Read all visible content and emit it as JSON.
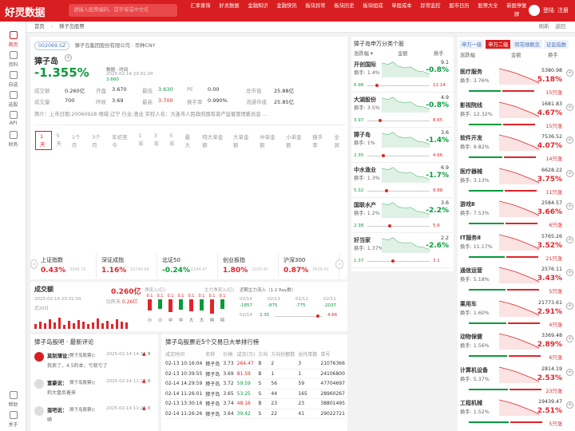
{
  "app": {
    "logo": "好灵数据",
    "search_placeholder": "请输入股票编码、首字母或中文名"
  },
  "nav": [
    "汇率查询",
    "好灵数据",
    "金融知识",
    "金融快讯",
    "板块异常",
    "板块历史",
    "板块组成",
    "单股成本",
    "异常监控",
    "股市日历",
    "股票大全",
    "新股停复牌"
  ],
  "user": {
    "login": "登陆",
    "register": "注册"
  },
  "sidebar": [
    {
      "label": "首页",
      "icon": "home-icon"
    },
    {
      "label": "资料",
      "icon": "doc-icon"
    },
    {
      "label": "自选",
      "icon": "star-icon"
    },
    {
      "label": "选股",
      "icon": "filter-icon"
    },
    {
      "label": "API",
      "icon": "api-icon"
    },
    {
      "label": "财务",
      "icon": "finance-icon"
    },
    {
      "label": "帮助",
      "icon": "help-icon"
    },
    {
      "label": "关于",
      "icon": "about-icon"
    }
  ],
  "breadcrumb": {
    "home": "首页",
    "current": "獐子岛股票",
    "refresh": "刷新",
    "back": "返回"
  },
  "stock": {
    "code": "002069.SZ",
    "company": "獐子岛集团股份有限公司 · 币种CNY",
    "name": "獐子岛",
    "time_label": "数据 · 时间",
    "time": "2025-02-14 23:01:34",
    "price": "3.660",
    "change": "-1.355%",
    "fields": [
      {
        "k": "成交额",
        "v": "0.260亿"
      },
      {
        "k": "开盘",
        "v": "3.670"
      },
      {
        "k": "最低",
        "v": "3.630"
      },
      {
        "k": "PE",
        "v": "0.00"
      },
      {
        "k": "总市值",
        "v": "25.88亿"
      },
      {
        "k": "成交量",
        "v": "700"
      },
      {
        "k": "昨收",
        "v": "3.69"
      },
      {
        "k": "最高",
        "v": "3.700"
      },
      {
        "k": "换手率",
        "v": "0.990%"
      },
      {
        "k": "流通市值",
        "v": "25.85亿"
      }
    ],
    "intro": "简介：上市日期:20060928 地域:辽宁 行业:渔业 实控人名：大连市人民政府国有资产监督管理委员会 ..."
  },
  "chart_tabs": [
    "1天",
    "5天",
    "1个月",
    "3个月",
    "年初至今",
    "1年",
    "3年",
    "5年",
    "最大",
    "特大单金额",
    "大单金额",
    "中单金额",
    "小单金额",
    "换手率",
    "全屏"
  ],
  "indices": [
    {
      "name": "上证指数",
      "pct": "0.43%",
      "sub": "3346.72",
      "dir": "up"
    },
    {
      "name": "深证成指",
      "pct": "1.16%",
      "sub": "10749.64",
      "dir": "up"
    },
    {
      "name": "北证50",
      "pct": "-0.24%",
      "sub": "1344.47",
      "dir": "down"
    },
    {
      "name": "创业板指",
      "pct": "1.80%",
      "sub": "2200.90",
      "dir": "up"
    },
    {
      "name": "沪深300",
      "pct": "0.87%",
      "sub": "3939.01",
      "dir": "up"
    }
  ],
  "volume": {
    "title": "成交额",
    "value": "0.260亿",
    "time": "2025-02-14 23:01:34",
    "ratio_label": "比昨天",
    "ratio": "0.26亿",
    "days_label": "近20日",
    "flow_label": "净流入(亿)",
    "main_label": "主力净流入(亿)",
    "flow_values": [
      "0.1",
      "0.1",
      "0.1",
      "0.1",
      "0.1",
      "0.1",
      "0.1",
      "0.1"
    ],
    "flow_cats": [
      "小",
      "小",
      "中",
      "中",
      "大",
      "大",
      "特",
      "特"
    ],
    "recent_title": "近期主力流入（1.2 Ray数）",
    "recent_dates": [
      "02/14",
      "02/13",
      "02/12",
      "02/11"
    ],
    "recent_vals": [
      "-1857",
      "-875",
      "-775",
      "-2037"
    ],
    "price_label": "02/14",
    "price_min": "2.35",
    "price_max": "4.66"
  },
  "comments": {
    "title": "獐子岛股吧 · 最新评论",
    "items": [
      {
        "user": "莫制薄设：",
        "src": "獐子岛股票()",
        "time": "2025-02-14 14:34",
        "likes": "8",
        "text": "我卖了，4.5的本，亏就亏了"
      },
      {
        "user": "富豪说：",
        "src": "獐子岛股票()",
        "time": "2025-02-14 11:27",
        "likes": "0",
        "text": "和大盘反着来"
      },
      {
        "user": "蛋吧说：",
        "src": "獐子岛股票()",
        "time": "2025-02-14 11:26",
        "likes": "0",
        "text": "嗬"
      }
    ]
  },
  "trades": {
    "title": "獐子岛股票近5个交易日大单排行榜",
    "headers": [
      "成交时间",
      "",
      "名称",
      "价格",
      "成交(万)",
      "方向",
      "方向份额数",
      "总托单数",
      "单号"
    ],
    "rows": [
      [
        "02-13 10:16:04",
        "獐子岛",
        "3.73",
        "264.47",
        "B",
        "2",
        "3",
        "21076366"
      ],
      [
        "02-13 10:39:55",
        "獐子岛",
        "3.69",
        "81.59",
        "B",
        "1",
        "1",
        "24106800"
      ],
      [
        "02-14 14:29:59",
        "獐子岛",
        "3.72",
        "59.59",
        "S",
        "56",
        "59",
        "47704697"
      ],
      [
        "02-14 11:26:01",
        "獐子岛",
        "3.65",
        "53.25",
        "S",
        "44",
        "165",
        "28960267"
      ],
      [
        "02-13 13:30:16",
        "獐子岛",
        "3.74",
        "48.16",
        "B",
        "23",
        "23",
        "38801495"
      ],
      [
        "02-14 11:26:26",
        "獐子岛",
        "3.64",
        "39.42",
        "S",
        "22",
        "41",
        "29022721"
      ]
    ]
  },
  "fish": {
    "title": "獐子岛申万分类个股",
    "cols": [
      "金额",
      "换手"
    ],
    "items": [
      {
        "name": "开创国际",
        "turnover": "换手: 1.4%",
        "price": "9.1",
        "pct": "-0.8%",
        "lo": "6.98",
        "hi": "12.14",
        "dir": "down"
      },
      {
        "name": "大湖股份",
        "turnover": "换手: 3.5%",
        "price": "4.9",
        "pct": "-0.8%",
        "lo": "3.97",
        "hi": "8.65",
        "dir": "down"
      },
      {
        "name": "獐子岛",
        "turnover": "换手: 1%",
        "price": "3.6",
        "pct": "-1.4%",
        "lo": "2.35",
        "hi": "4.66",
        "dir": "down"
      },
      {
        "name": "中水渔业",
        "turnover": "换手: 1.3%",
        "price": "6.9",
        "pct": "-1.7%",
        "lo": "5.32",
        "hi": "8.88",
        "dir": "down"
      },
      {
        "name": "国联水产",
        "turnover": "换手: 1.2%",
        "price": "3.6",
        "pct": "-2.2%",
        "lo": "2.38",
        "hi": "5.6",
        "dir": "down"
      },
      {
        "name": "好当家",
        "turnover": "换手: 1.37%",
        "price": "2.2",
        "pct": "-2.6%",
        "lo": "1.37",
        "hi": "3.1",
        "dir": "down"
      }
    ]
  },
  "industry": {
    "tabs": [
      "申万一级",
      "申万二级",
      "同花顺概念",
      "证监指数"
    ],
    "cols": [
      "涨跌幅",
      "金额",
      "换手"
    ],
    "items": [
      {
        "name": "医疗服务",
        "turnover": "换手: 3.76%",
        "price": "5380.98",
        "pct": "5.18%",
        "vol": "15只涨"
      },
      {
        "name": "影视院线",
        "turnover": "换手: 12.32%",
        "price": "1681.83",
        "pct": "4.67%",
        "vol": "15只涨"
      },
      {
        "name": "软件开发",
        "turnover": "换手: 9.82%",
        "price": "7536.52",
        "pct": "4.07%",
        "vol": "14只涨"
      },
      {
        "name": "医疗器械",
        "turnover": "换手: 3.13%",
        "price": "6628.22",
        "pct": "3.75%",
        "vol": "11只涨"
      },
      {
        "name": "游戏Ⅱ",
        "turnover": "换手: 7.53%",
        "price": "2584.57",
        "pct": "3.66%",
        "vol": "6只涨"
      },
      {
        "name": "IT服务Ⅱ",
        "turnover": "换手: 11.17%",
        "price": "5765.26",
        "pct": "3.52%",
        "vol": "21只涨"
      },
      {
        "name": "通信运营",
        "turnover": "换手: 5.18%",
        "price": "2576.11",
        "pct": "3.43%",
        "vol": "5只涨"
      },
      {
        "name": "乘用车",
        "turnover": "换手: 1.60%",
        "price": "21773.61",
        "pct": "2.91%",
        "vol": "4只涨"
      },
      {
        "name": "动物保健",
        "turnover": "换手: 1.56%",
        "price": "3369.48",
        "pct": "2.89%",
        "vol": "6只涨"
      },
      {
        "name": "计算机设备",
        "turnover": "换手: 5.37%",
        "price": "2814.19",
        "pct": "2.53%",
        "vol": "23只涨"
      },
      {
        "name": "工程机械",
        "turnover": "换手: 1.52%",
        "price": "19439.47",
        "pct": "2.51%",
        "vol": "5只涨"
      }
    ]
  }
}
